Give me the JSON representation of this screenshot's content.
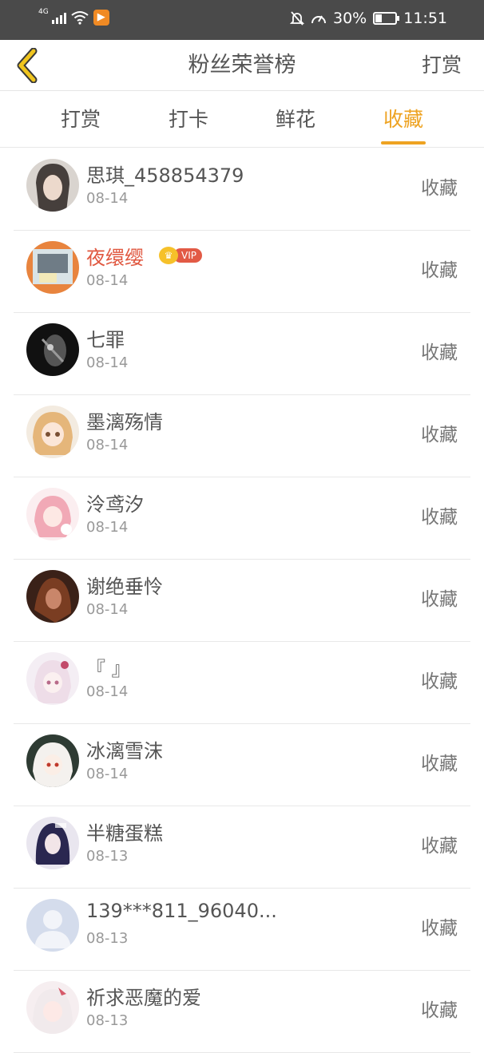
{
  "status_bar": {
    "network": "4G",
    "battery": "30%",
    "battery_level": 0.3,
    "time": "11:51",
    "icons": [
      "signal-icon",
      "wifi-icon",
      "app-notification-icon",
      "mute-icon",
      "speed-icon",
      "battery-icon"
    ]
  },
  "nav": {
    "title": "粉丝荣誉榜",
    "right_action": "打赏"
  },
  "tabs": [
    {
      "label": "打赏"
    },
    {
      "label": "打卡"
    },
    {
      "label": "鲜花"
    },
    {
      "label": "收藏",
      "active": true
    }
  ],
  "colors": {
    "accent": "#eea322",
    "vip_name": "#e0573f",
    "text": "#555555",
    "subtext": "#999999"
  },
  "fans": [
    {
      "name": "思琪_458854379",
      "date": "08-14",
      "action": "收藏"
    },
    {
      "name": "夜缳缨",
      "date": "08-14",
      "action": "收藏",
      "vip": "VIP"
    },
    {
      "name": "七罪",
      "date": "08-14",
      "action": "收藏"
    },
    {
      "name": "墨漓殇情",
      "date": "08-14",
      "action": "收藏"
    },
    {
      "name": "泠鸢汐",
      "date": "08-14",
      "action": "收藏"
    },
    {
      "name": "谢绝垂怜",
      "date": "08-14",
      "action": "收藏"
    },
    {
      "name": "『 』",
      "date": "08-14",
      "action": "收藏"
    },
    {
      "name": "冰漓雪沫",
      "date": "08-14",
      "action": "收藏"
    },
    {
      "name": "半糖蛋糕",
      "date": "08-13",
      "action": "收藏"
    },
    {
      "name": "139***811_96040...",
      "date": "08-13",
      "action": "收藏"
    },
    {
      "name": "祈求恶魔的爱",
      "date": "08-13",
      "action": "收藏"
    }
  ]
}
